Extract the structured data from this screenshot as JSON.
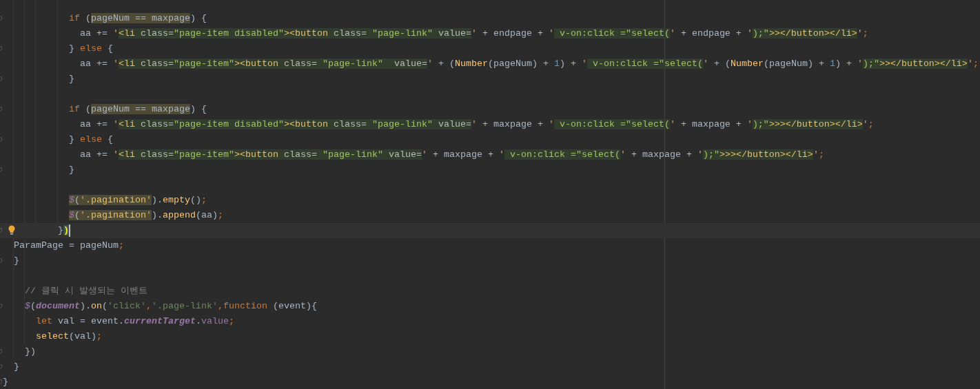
{
  "editor": {
    "lines": [
      {
        "kind": "code",
        "fold": true,
        "tokens": [
          {
            "t": "            if",
            "kind": "kw"
          },
          {
            "t": " (",
            "kind": "plain"
          },
          {
            "t": "pageNum == maxpage",
            "kind": "plain",
            "matched": true
          },
          {
            "t": ") {",
            "kind": "plain"
          }
        ]
      },
      {
        "kind": "code",
        "tokens": [
          {
            "t": "              aa += ",
            "kind": "plain"
          },
          {
            "t": "'",
            "kind": "quote"
          },
          {
            "t": "<li",
            "kind": "tag",
            "injected": true
          },
          {
            "t": " class=",
            "kind": "attr",
            "injected": true
          },
          {
            "t": "\"page-item disabled\"",
            "kind": "val",
            "injected": true
          },
          {
            "t": "><button",
            "kind": "tag",
            "injected": true
          },
          {
            "t": " class= ",
            "kind": "attr",
            "injected": true
          },
          {
            "t": "\"page-link\"",
            "kind": "val",
            "injected": true
          },
          {
            "t": " value=",
            "kind": "attr",
            "injected": true
          },
          {
            "t": "'",
            "kind": "quote"
          },
          {
            "t": " + endpage + ",
            "kind": "plain"
          },
          {
            "t": "'",
            "kind": "quote"
          },
          {
            "t": " v-on:click =\"select(",
            "kind": "val",
            "injected": true
          },
          {
            "t": "'",
            "kind": "quote"
          },
          {
            "t": " + endpage + ",
            "kind": "plain"
          },
          {
            "t": "'",
            "kind": "quote"
          },
          {
            "t": ");\"",
            "kind": "val",
            "injected": true
          },
          {
            "t": ">></button></li>",
            "kind": "tag",
            "injected": true
          },
          {
            "t": "'",
            "kind": "quote"
          },
          {
            "t": ";",
            "kind": "punct"
          }
        ]
      },
      {
        "kind": "code",
        "fold": true,
        "tokens": [
          {
            "t": "            } ",
            "kind": "plain"
          },
          {
            "t": "else",
            "kind": "kw"
          },
          {
            "t": " {",
            "kind": "plain"
          }
        ]
      },
      {
        "kind": "code",
        "tokens": [
          {
            "t": "              aa += ",
            "kind": "plain"
          },
          {
            "t": "'",
            "kind": "quote"
          },
          {
            "t": "<li",
            "kind": "tag",
            "injected": true
          },
          {
            "t": " class=",
            "kind": "attr",
            "injected": true
          },
          {
            "t": "\"page-item\"",
            "kind": "val",
            "injected": true
          },
          {
            "t": "><button",
            "kind": "tag",
            "injected": true
          },
          {
            "t": " class= ",
            "kind": "attr",
            "injected": true
          },
          {
            "t": "\"page-link\"",
            "kind": "val",
            "injected": true
          },
          {
            "t": "  value=",
            "kind": "attr",
            "injected": true
          },
          {
            "t": "'",
            "kind": "quote"
          },
          {
            "t": " + (",
            "kind": "plain"
          },
          {
            "t": "Number",
            "kind": "fn"
          },
          {
            "t": "(pageNum) + ",
            "kind": "plain"
          },
          {
            "t": "1",
            "kind": "num"
          },
          {
            "t": ") + ",
            "kind": "plain"
          },
          {
            "t": "'",
            "kind": "quote"
          },
          {
            "t": " v-on:click =\"select(",
            "kind": "val",
            "injected": true
          },
          {
            "t": "'",
            "kind": "quote"
          },
          {
            "t": " + (",
            "kind": "plain"
          },
          {
            "t": "Number",
            "kind": "fn"
          },
          {
            "t": "(pageNum) + ",
            "kind": "plain"
          },
          {
            "t": "1",
            "kind": "num"
          },
          {
            "t": ") + ",
            "kind": "plain"
          },
          {
            "t": "'",
            "kind": "quote"
          },
          {
            "t": ");\"",
            "kind": "val",
            "injected": true
          },
          {
            "t": ">></button></li>",
            "kind": "tag",
            "injected": true
          },
          {
            "t": "'",
            "kind": "quote"
          },
          {
            "t": ";",
            "kind": "punct"
          }
        ]
      },
      {
        "kind": "code",
        "fold": true,
        "tokens": [
          {
            "t": "            }",
            "kind": "plain"
          }
        ]
      },
      {
        "kind": "blank"
      },
      {
        "kind": "code",
        "fold": true,
        "tokens": [
          {
            "t": "            if",
            "kind": "kw"
          },
          {
            "t": " (",
            "kind": "plain"
          },
          {
            "t": "pageNum == maxpage",
            "kind": "plain",
            "matched": true
          },
          {
            "t": ") {",
            "kind": "plain"
          }
        ]
      },
      {
        "kind": "code",
        "tokens": [
          {
            "t": "              aa += ",
            "kind": "plain"
          },
          {
            "t": "'",
            "kind": "quote"
          },
          {
            "t": "<li",
            "kind": "tag",
            "injected": true
          },
          {
            "t": " class=",
            "kind": "attr",
            "injected": true
          },
          {
            "t": "\"page-item disabled\"",
            "kind": "val",
            "injected": true
          },
          {
            "t": "><button",
            "kind": "tag",
            "injected": true
          },
          {
            "t": " class= ",
            "kind": "attr",
            "injected": true
          },
          {
            "t": "\"page-link\"",
            "kind": "val",
            "injected": true
          },
          {
            "t": " value=",
            "kind": "attr",
            "injected": true
          },
          {
            "t": "'",
            "kind": "quote"
          },
          {
            "t": " + maxpage + ",
            "kind": "plain"
          },
          {
            "t": "'",
            "kind": "quote"
          },
          {
            "t": " v-on:click =\"select(",
            "kind": "val",
            "injected": true
          },
          {
            "t": "'",
            "kind": "quote"
          },
          {
            "t": " + maxpage + ",
            "kind": "plain"
          },
          {
            "t": "'",
            "kind": "quote"
          },
          {
            "t": ");\"",
            "kind": "val",
            "injected": true
          },
          {
            "t": ">>></button></li>",
            "kind": "tag",
            "injected": true
          },
          {
            "t": "'",
            "kind": "quote"
          },
          {
            "t": ";",
            "kind": "punct"
          }
        ]
      },
      {
        "kind": "code",
        "fold": true,
        "tokens": [
          {
            "t": "            } ",
            "kind": "plain"
          },
          {
            "t": "else",
            "kind": "kw"
          },
          {
            "t": " {",
            "kind": "plain"
          }
        ]
      },
      {
        "kind": "code",
        "tokens": [
          {
            "t": "              aa += ",
            "kind": "plain"
          },
          {
            "t": "'",
            "kind": "quote"
          },
          {
            "t": "<li",
            "kind": "tag",
            "injected": true
          },
          {
            "t": " class=",
            "kind": "attr",
            "injected": true
          },
          {
            "t": "\"page-item\"",
            "kind": "val",
            "injected": true
          },
          {
            "t": "><button",
            "kind": "tag",
            "injected": true
          },
          {
            "t": " class= ",
            "kind": "attr",
            "injected": true
          },
          {
            "t": "\"page-link\"",
            "kind": "val",
            "injected": true
          },
          {
            "t": " value=",
            "kind": "attr",
            "injected": true
          },
          {
            "t": "'",
            "kind": "quote"
          },
          {
            "t": " + maxpage + ",
            "kind": "plain"
          },
          {
            "t": "'",
            "kind": "quote"
          },
          {
            "t": " v-on:click =\"select(",
            "kind": "val",
            "injected": true
          },
          {
            "t": "'",
            "kind": "quote"
          },
          {
            "t": " + maxpage + ",
            "kind": "plain"
          },
          {
            "t": "'",
            "kind": "quote"
          },
          {
            "t": ");\"",
            "kind": "val",
            "injected": true
          },
          {
            "t": ">>></button></li>",
            "kind": "tag",
            "injected": true
          },
          {
            "t": "'",
            "kind": "quote"
          },
          {
            "t": ";",
            "kind": "punct"
          }
        ]
      },
      {
        "kind": "code",
        "fold": true,
        "tokens": [
          {
            "t": "            }",
            "kind": "plain"
          }
        ]
      },
      {
        "kind": "blank"
      },
      {
        "kind": "code",
        "tokens": [
          {
            "t": "            $",
            "kind": "global",
            "matched": true
          },
          {
            "t": "(",
            "kind": "plain",
            "matched": true
          },
          {
            "t": "'",
            "kind": "quote",
            "matched": true
          },
          {
            "t": ".pagination",
            "kind": "sel",
            "matched": true
          },
          {
            "t": "'",
            "kind": "quote",
            "matched": true
          },
          {
            "t": ").",
            "kind": "plain"
          },
          {
            "t": "empty",
            "kind": "fn"
          },
          {
            "t": "()",
            "kind": "plain"
          },
          {
            "t": ";",
            "kind": "punct"
          }
        ]
      },
      {
        "kind": "code",
        "tokens": [
          {
            "t": "            $",
            "kind": "global",
            "matched": true
          },
          {
            "t": "(",
            "kind": "plain",
            "matched": true
          },
          {
            "t": "'",
            "kind": "quote",
            "matched": true
          },
          {
            "t": ".pagination",
            "kind": "sel",
            "matched": true
          },
          {
            "t": "'",
            "kind": "quote",
            "matched": true
          },
          {
            "t": ").",
            "kind": "plain"
          },
          {
            "t": "append",
            "kind": "fn"
          },
          {
            "t": "(aa)",
            "kind": "plain"
          },
          {
            "t": ";",
            "kind": "punct"
          }
        ]
      },
      {
        "kind": "code",
        "fold": true,
        "current": true,
        "bulb": true,
        "caret": true,
        "tokens": [
          {
            "t": "          }",
            "kind": "plain"
          },
          {
            "t": ")",
            "kind": "plain",
            "brace_match": true
          }
        ]
      },
      {
        "kind": "code",
        "tokens": [
          {
            "t": "  ParamPage = pageNum",
            "kind": "plain"
          },
          {
            "t": ";",
            "kind": "punct"
          }
        ]
      },
      {
        "kind": "code",
        "fold": true,
        "tokens": [
          {
            "t": "  }",
            "kind": "plain"
          }
        ]
      },
      {
        "kind": "blank"
      },
      {
        "kind": "comment",
        "tokens": [
          {
            "t": "    // 클릭 시 발생되는 이벤트",
            "kind": "comment"
          }
        ]
      },
      {
        "kind": "code",
        "fold": true,
        "tokens": [
          {
            "t": "    $",
            "kind": "global"
          },
          {
            "t": "(",
            "kind": "plain"
          },
          {
            "t": "document",
            "kind": "prop"
          },
          {
            "t": ").",
            "kind": "plain"
          },
          {
            "t": "on",
            "kind": "fn"
          },
          {
            "t": "(",
            "kind": "plain"
          },
          {
            "t": "'click'",
            "kind": "str"
          },
          {
            "t": ",",
            "kind": "punct"
          },
          {
            "t": "'.page-link'",
            "kind": "str"
          },
          {
            "t": ",",
            "kind": "punct"
          },
          {
            "t": "function",
            "kind": "kw"
          },
          {
            "t": " (event){",
            "kind": "plain"
          }
        ]
      },
      {
        "kind": "code",
        "tokens": [
          {
            "t": "      let",
            "kind": "kw"
          },
          {
            "t": " val = event.",
            "kind": "plain"
          },
          {
            "t": "currentTarget",
            "kind": "prop"
          },
          {
            "t": ".",
            "kind": "plain"
          },
          {
            "t": "value",
            "kind": "field"
          },
          {
            "t": ";",
            "kind": "punct"
          }
        ]
      },
      {
        "kind": "code",
        "tokens": [
          {
            "t": "      select",
            "kind": "fn"
          },
          {
            "t": "(val)",
            "kind": "plain"
          },
          {
            "t": ";",
            "kind": "punct"
          }
        ]
      },
      {
        "kind": "code",
        "fold": true,
        "tokens": [
          {
            "t": "    })",
            "kind": "plain"
          }
        ]
      },
      {
        "kind": "code",
        "fold": true,
        "tokens": [
          {
            "t": "  }",
            "kind": "plain"
          }
        ]
      },
      {
        "kind": "code",
        "fold": true,
        "tokens": [
          {
            "t": "}",
            "kind": "plain"
          }
        ]
      }
    ]
  }
}
